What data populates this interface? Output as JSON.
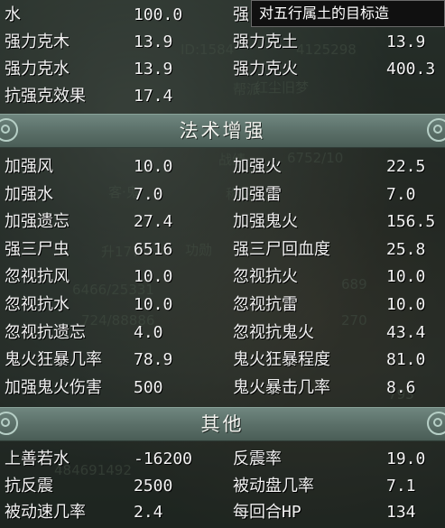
{
  "tooltip": "对五行属土的目标造",
  "background_text": [
    "ID:1584",
    "4125298",
    "帮派",
    "红尘旧梦",
    "战绩",
    "6752/10",
    "客·鬼",
    "称谓",
    "升177",
    "功勋",
    "6466/25331",
    "689",
    "724/88886",
    "270",
    "484691492",
    "793"
  ],
  "top_rows": [
    {
      "n1": "水",
      "v1": "100.0",
      "n2": "强",
      "v2": ""
    },
    {
      "n1": "强力克木",
      "v1": "13.9",
      "n2": "强力克土",
      "v2": "13.9"
    },
    {
      "n1": "强力克水",
      "v1": "13.9",
      "n2": "强力克火",
      "v2": "400.3"
    },
    {
      "n1": "抗强克效果",
      "v1": "17.4",
      "n2": "",
      "v2": ""
    }
  ],
  "section_magic": {
    "title": "法术增强",
    "rows": [
      {
        "n1": "加强风",
        "v1": "10.0",
        "n2": "加强火",
        "v2": "22.5"
      },
      {
        "n1": "加强水",
        "v1": "7.0",
        "n2": "加强雷",
        "v2": "7.0"
      },
      {
        "n1": "加强遗忘",
        "v1": "27.4",
        "n2": "加强鬼火",
        "v2": "156.5"
      },
      {
        "n1": "强三尸虫",
        "v1": "6516",
        "n2": "强三尸回血度",
        "v2": "25.8"
      },
      {
        "n1": "忽视抗风",
        "v1": "10.0",
        "n2": "忽视抗火",
        "v2": "10.0"
      },
      {
        "n1": "忽视抗水",
        "v1": "10.0",
        "n2": "忽视抗雷",
        "v2": "10.0"
      },
      {
        "n1": "忽视抗遗忘",
        "v1": "4.0",
        "n2": "忽视抗鬼火",
        "v2": "43.4"
      },
      {
        "n1": "鬼火狂暴几率",
        "v1": "78.9",
        "n2": "鬼火狂暴程度",
        "v2": "81.0"
      },
      {
        "n1": "加强鬼火伤害",
        "v1": "500",
        "n2": "鬼火暴击几率",
        "v2": "8.6"
      }
    ]
  },
  "section_other": {
    "title": "其他",
    "rows": [
      {
        "n1": "上善若水",
        "v1": "-16200",
        "n2": "反震率",
        "v2": "19.0"
      },
      {
        "n1": "抗反震",
        "v1": "2500",
        "n2": "被动盘几率",
        "v2": "7.1"
      },
      {
        "n1": "被动速几率",
        "v1": "2.4",
        "n2": "每回合HP",
        "v2": "134"
      }
    ]
  }
}
